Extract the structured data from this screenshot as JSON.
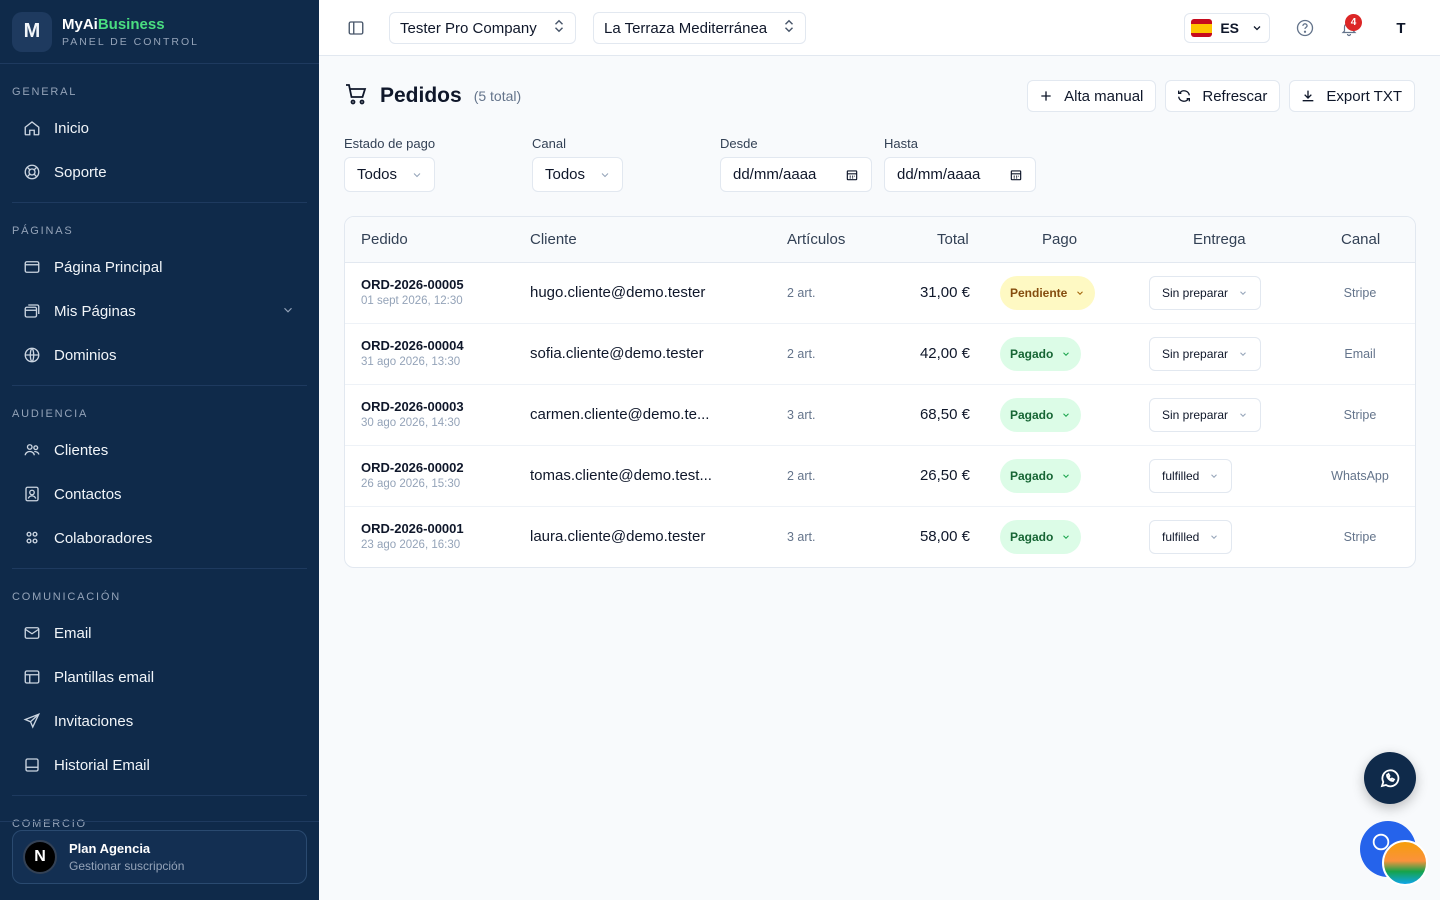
{
  "brand": {
    "name_a": "MyAi",
    "name_b": "Business",
    "subtitle": "PANEL DE CONTROL",
    "logo_letter": "M"
  },
  "sidebar": {
    "sections": [
      {
        "title": "GENERAL",
        "items": [
          {
            "label": "Inicio",
            "icon": "home-icon"
          },
          {
            "label": "Soporte",
            "icon": "lifebuoy-icon"
          }
        ]
      },
      {
        "title": "PÁGINAS",
        "items": [
          {
            "label": "Página Principal",
            "icon": "window-icon"
          },
          {
            "label": "Mis Páginas",
            "icon": "windows-icon"
          },
          {
            "label": "Dominios",
            "icon": "globe-icon"
          }
        ]
      },
      {
        "title": "AUDIENCIA",
        "items": [
          {
            "label": "Clientes",
            "icon": "users-icon"
          },
          {
            "label": "Contactos",
            "icon": "contact-icon"
          },
          {
            "label": "Colaboradores",
            "icon": "team-icon"
          }
        ]
      },
      {
        "title": "COMUNICACIÓN",
        "items": [
          {
            "label": "Email",
            "icon": "mail-icon"
          },
          {
            "label": "Plantillas email",
            "icon": "template-icon"
          },
          {
            "label": "Invitaciones",
            "icon": "send-icon"
          },
          {
            "label": "Historial Email",
            "icon": "history-icon"
          }
        ]
      },
      {
        "title": "COMERCIO"
      }
    ],
    "plan": {
      "avatar": "N",
      "title": "Plan Agencia",
      "subtitle": "Gestionar suscripción"
    }
  },
  "topbar": {
    "company": "Tester Pro Company",
    "site": "La Terraza Mediterránea",
    "language": "ES",
    "notifications": "4",
    "user_initial": "T"
  },
  "page": {
    "title": "Pedidos",
    "count": "(5 total)",
    "actions": {
      "manual": "Alta manual",
      "refresh": "Refrescar",
      "export": "Export TXT"
    }
  },
  "filters": {
    "estado": {
      "label": "Estado de pago",
      "value": "Todos"
    },
    "canal": {
      "label": "Canal",
      "value": "Todos"
    },
    "desde": {
      "label": "Desde",
      "value": "dd/mm/aaaa"
    },
    "hasta": {
      "label": "Hasta",
      "value": "dd/mm/aaaa"
    }
  },
  "table": {
    "headers": [
      "Pedido",
      "Cliente",
      "Artículos",
      "Total",
      "Pago",
      "Entrega",
      "Canal"
    ],
    "rows": [
      {
        "id": "ORD-2026-00005",
        "date": "01 sept 2026, 12:30",
        "client": "hugo.cliente@demo.tester",
        "items": "2 art.",
        "total": "31,00 €",
        "payment": "Pendiente",
        "payment_status": "pending",
        "delivery": "Sin preparar",
        "channel": "Stripe"
      },
      {
        "id": "ORD-2026-00004",
        "date": "31 ago 2026, 13:30",
        "client": "sofia.cliente@demo.tester",
        "items": "2 art.",
        "total": "42,00 €",
        "payment": "Pagado",
        "payment_status": "paid",
        "delivery": "Sin preparar",
        "channel": "Email"
      },
      {
        "id": "ORD-2026-00003",
        "date": "30 ago 2026, 14:30",
        "client": "carmen.cliente@demo.te...",
        "items": "3 art.",
        "total": "68,50 €",
        "payment": "Pagado",
        "payment_status": "paid",
        "delivery": "Sin preparar",
        "channel": "Stripe"
      },
      {
        "id": "ORD-2026-00002",
        "date": "26 ago 2026, 15:30",
        "client": "tomas.cliente@demo.test...",
        "items": "2 art.",
        "total": "26,50 €",
        "payment": "Pagado",
        "payment_status": "paid",
        "delivery": "fulfilled",
        "channel": "WhatsApp"
      },
      {
        "id": "ORD-2026-00001",
        "date": "23 ago 2026, 16:30",
        "client": "laura.cliente@demo.tester",
        "items": "3 art.",
        "total": "58,00 €",
        "payment": "Pagado",
        "payment_status": "paid",
        "delivery": "fulfilled",
        "channel": "Stripe"
      }
    ]
  },
  "colors": {
    "sidebar_bg": "#0f2a4a",
    "pending_bg": "#fef9c3",
    "paid_bg": "#dcfce7",
    "brand_accent": "#4ade80"
  }
}
